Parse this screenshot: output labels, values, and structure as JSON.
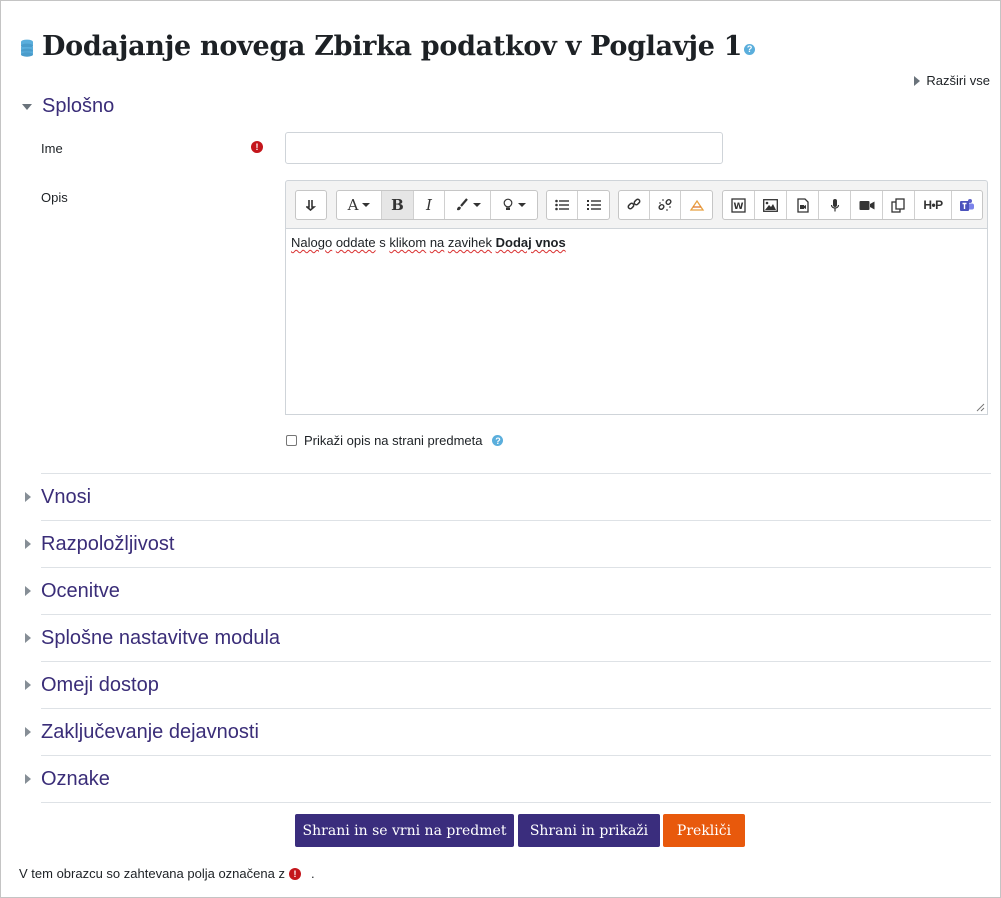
{
  "page": {
    "title": "Dodajanje novega Zbirka podatkov v Poglavje 1",
    "expand_all": "Razširi vse",
    "footer_note": "V tem obrazcu so zahtevana polja označena z",
    "footer_period": "."
  },
  "general": {
    "title": "Splošno",
    "name_label": "Ime",
    "name_value": "",
    "description_label": "Opis",
    "show_description_label": "Prikaži opis na strani predmeta",
    "show_description_checked": false
  },
  "editor": {
    "text_part1": "Nalogo",
    "text_part2": "oddate",
    "text_part3": "s",
    "text_part4": "klikom",
    "text_part5": "na",
    "text_part6": "zavihek",
    "text_bold": "Dodaj vnos",
    "toolbar": {
      "font_color_label": "A",
      "bold_label": "B",
      "italic_label": "I",
      "h5p_label": "H•P"
    }
  },
  "sections": [
    {
      "title": "Vnosi"
    },
    {
      "title": "Razpoložljivost"
    },
    {
      "title": "Ocenitve"
    },
    {
      "title": "Splošne nastavitve modula"
    },
    {
      "title": "Omeji dostop"
    },
    {
      "title": "Zaključevanje dejavnosti"
    },
    {
      "title": "Oznake"
    }
  ],
  "buttons": {
    "save_return": "Shrani in se vrni na predmet",
    "save_display": "Shrani in prikaži",
    "cancel": "Prekliči"
  },
  "colors": {
    "section_title": "#3a2d78",
    "primary_button": "#3a2d7d",
    "cancel_button": "#e8590c",
    "required": "#c4161c",
    "help": "#5aaedc"
  }
}
